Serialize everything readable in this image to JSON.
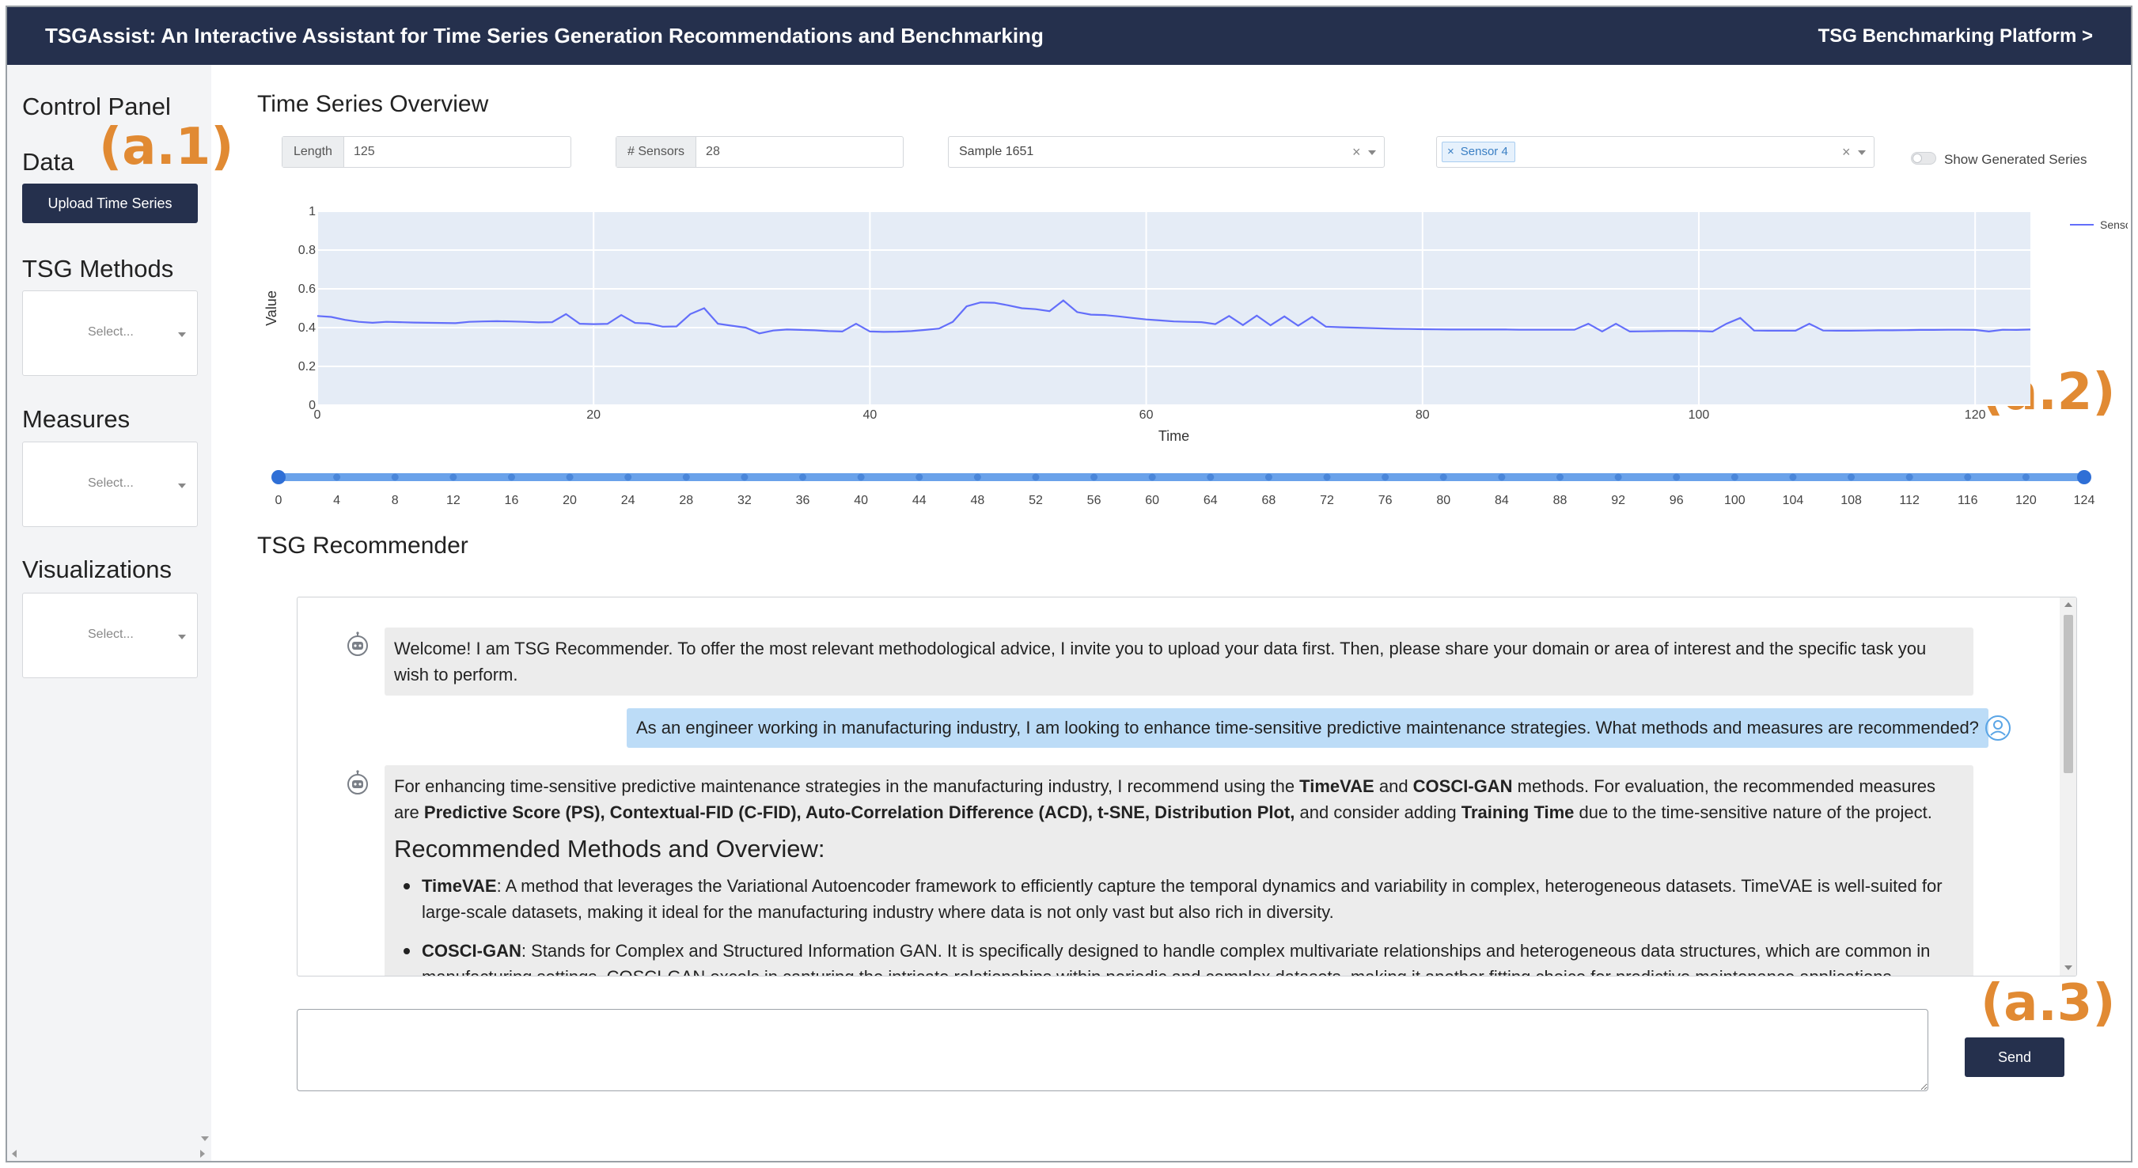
{
  "header": {
    "title": "TSGAssist: An Interactive Assistant for Time Series Generation Recommendations and Benchmarking",
    "platform_link": "TSG Benchmarking Platform >"
  },
  "sidebar": {
    "title": "Control Panel",
    "data_label": "Data",
    "upload_label": "Upload Time Series",
    "methods_label": "TSG Methods",
    "measures_label": "Measures",
    "visualizations_label": "Visualizations",
    "select_placeholder": "Select..."
  },
  "annotations": {
    "a1": "(a.1)",
    "a2": "(a.2)",
    "a3": "(a.3)"
  },
  "overview": {
    "title": "Time Series Overview",
    "length_label": "Length",
    "length_value": "125",
    "sensors_label": "# Sensors",
    "sensors_value": "28",
    "sample_value": "Sample 1651",
    "sensor_tag": "Sensor 4",
    "clear_symbol": "×",
    "toggle_label": "Show Generated Series",
    "toggle_on": false
  },
  "chart_data": {
    "type": "line",
    "title": "",
    "xlabel": "Time",
    "ylabel": "Value",
    "xlim": [
      0,
      124
    ],
    "ylim": [
      0,
      1
    ],
    "x_ticks": [
      0,
      20,
      40,
      60,
      80,
      100,
      120
    ],
    "y_ticks": [
      0,
      0.2,
      0.4,
      0.6,
      0.8,
      1
    ],
    "y_tick_labels": [
      "0",
      "0.2",
      "0.4",
      "0.6",
      "0.8",
      "1"
    ],
    "grid": true,
    "legend": "top-right",
    "series": [
      {
        "name": "Sensor 4",
        "color": "#636efa",
        "x": [
          0,
          1,
          2,
          3,
          4,
          5,
          6,
          7,
          8,
          9,
          10,
          11,
          12,
          13,
          14,
          15,
          16,
          17,
          18,
          19,
          20,
          21,
          22,
          23,
          24,
          25,
          26,
          27,
          28,
          29,
          30,
          31,
          32,
          33,
          34,
          35,
          36,
          37,
          38,
          39,
          40,
          41,
          42,
          43,
          44,
          45,
          46,
          47,
          48,
          49,
          50,
          51,
          52,
          53,
          54,
          55,
          56,
          57,
          58,
          59,
          60,
          61,
          62,
          63,
          64,
          65,
          66,
          67,
          68,
          69,
          70,
          71,
          72,
          73,
          74,
          75,
          76,
          77,
          78,
          79,
          80,
          81,
          82,
          83,
          84,
          85,
          86,
          87,
          88,
          89,
          90,
          91,
          92,
          93,
          94,
          95,
          96,
          97,
          98,
          99,
          100,
          101,
          102,
          103,
          104,
          105,
          106,
          107,
          108,
          109,
          110,
          111,
          112,
          113,
          114,
          115,
          116,
          117,
          118,
          119,
          120,
          121,
          122,
          123,
          124
        ],
        "values": [
          0.46,
          0.455,
          0.44,
          0.43,
          0.425,
          0.43,
          0.428,
          0.426,
          0.425,
          0.424,
          0.423,
          0.43,
          0.432,
          0.433,
          0.432,
          0.43,
          0.427,
          0.428,
          0.47,
          0.42,
          0.418,
          0.419,
          0.465,
          0.424,
          0.421,
          0.405,
          0.406,
          0.47,
          0.5,
          0.42,
          0.41,
          0.4,
          0.37,
          0.385,
          0.39,
          0.388,
          0.386,
          0.382,
          0.38,
          0.42,
          0.38,
          0.378,
          0.379,
          0.382,
          0.388,
          0.395,
          0.43,
          0.51,
          0.53,
          0.528,
          0.515,
          0.5,
          0.495,
          0.485,
          0.54,
          0.48,
          0.467,
          0.465,
          0.458,
          0.45,
          0.442,
          0.437,
          0.432,
          0.43,
          0.428,
          0.418,
          0.46,
          0.413,
          0.462,
          0.412,
          0.458,
          0.41,
          0.455,
          0.405,
          0.402,
          0.4,
          0.398,
          0.396,
          0.394,
          0.393,
          0.392,
          0.391,
          0.39,
          0.39,
          0.39,
          0.39,
          0.39,
          0.389,
          0.389,
          0.389,
          0.389,
          0.389,
          0.42,
          0.38,
          0.42,
          0.38,
          0.381,
          0.382,
          0.383,
          0.383,
          0.382,
          0.38,
          0.42,
          0.45,
          0.385,
          0.384,
          0.384,
          0.384,
          0.42,
          0.385,
          0.384,
          0.384,
          0.385,
          0.386,
          0.386,
          0.387,
          0.388,
          0.388,
          0.389,
          0.389,
          0.388,
          0.38,
          0.389,
          0.388,
          0.39
        ]
      }
    ]
  },
  "slider": {
    "min": 0,
    "max": 124,
    "range": [
      0,
      124
    ],
    "marks": [
      "0",
      "4",
      "8",
      "12",
      "16",
      "20",
      "24",
      "28",
      "32",
      "36",
      "40",
      "44",
      "48",
      "52",
      "56",
      "60",
      "64",
      "68",
      "72",
      "76",
      "80",
      "84",
      "88",
      "92",
      "96",
      "100",
      "104",
      "108",
      "112",
      "116",
      "120",
      "124"
    ]
  },
  "recommender": {
    "title": "TSG Recommender",
    "welcome": "Welcome! I am TSG Recommender. To offer the most relevant methodological advice, I invite you to upload your data first. Then, please share your domain or area of interest and the specific task you wish to perform.",
    "user_message": "As an engineer working in manufacturing industry, I am looking to enhance time-sensitive predictive maintenance strategies. What methods and measures are recommended?",
    "reply": {
      "t1": "For enhancing time-sensitive predictive maintenance strategies in the manufacturing industry, I recommend using the ",
      "b1": "TimeVAE",
      "t2": " and ",
      "b2": "COSCI-GAN",
      "t3": " methods. For evaluation, the recommended measures are ",
      "b3": "Predictive Score (PS), Contextual-FID (C-FID), Auto-Correlation Difference (ACD), t-SNE, Distribution Plot,",
      "t4": " and consider adding ",
      "b4": "Training Time",
      "t5": " due to the time-sensitive nature of the project.",
      "heading": "Recommended Methods and Overview:",
      "item1_name": "TimeVAE",
      "item1_text": ": A method that leverages the Variational Autoencoder framework to efficiently capture the temporal dynamics and variability in complex, heterogeneous datasets. TimeVAE is well-suited for large-scale datasets, making it ideal for the manufacturing industry where data is not only vast but also rich in diversity.",
      "item2_name": "COSCI-GAN",
      "item2_text": ": Stands for Complex and Structured Information GAN. It is specifically designed to handle complex multivariate relationships and heterogeneous data structures, which are common in manufacturing settings. COSCI-GAN excels in capturing the intricate relationships within periodic and complex datasets, making it another fitting choice for predictive maintenance applications."
    },
    "send_label": "Send"
  }
}
